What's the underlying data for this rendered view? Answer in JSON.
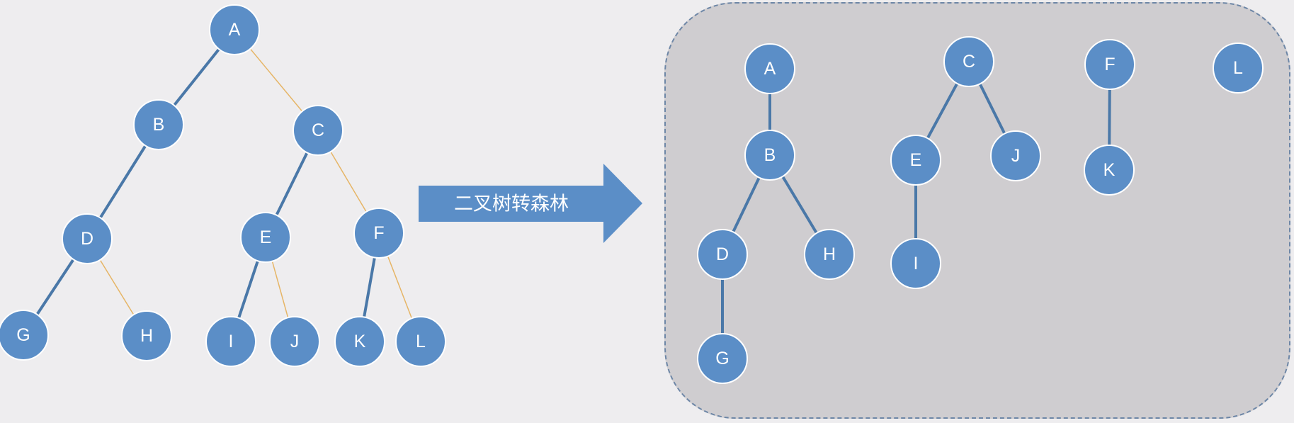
{
  "colors": {
    "background": "#eeedef",
    "panel": "#cfcdd0",
    "panel_border": "#6d86a6",
    "node_fill": "#5b8ec7",
    "node_stroke": "#ffffff",
    "child_edge": "#4a78a8",
    "sibling_edge": "#e6b566",
    "arrow_fill": "#5b8ec7"
  },
  "arrow": {
    "label": "二叉树转森林"
  },
  "binary_tree": {
    "nodes": [
      "A",
      "B",
      "C",
      "D",
      "E",
      "F",
      "G",
      "H",
      "I",
      "J",
      "K",
      "L"
    ],
    "edges": [
      {
        "from": "A",
        "to": "B",
        "kind": "left-child"
      },
      {
        "from": "A",
        "to": "C",
        "kind": "right-sibling"
      },
      {
        "from": "B",
        "to": "D",
        "kind": "left-child"
      },
      {
        "from": "C",
        "to": "E",
        "kind": "left-child"
      },
      {
        "from": "C",
        "to": "F",
        "kind": "right-sibling"
      },
      {
        "from": "D",
        "to": "G",
        "kind": "left-child"
      },
      {
        "from": "D",
        "to": "H",
        "kind": "right-sibling"
      },
      {
        "from": "E",
        "to": "I",
        "kind": "left-child"
      },
      {
        "from": "E",
        "to": "J",
        "kind": "right-sibling"
      },
      {
        "from": "F",
        "to": "K",
        "kind": "left-child"
      },
      {
        "from": "F",
        "to": "L",
        "kind": "right-sibling"
      }
    ]
  },
  "forest": {
    "trees": [
      {
        "root": "A",
        "nodes": [
          "A",
          "B",
          "D",
          "H",
          "G"
        ],
        "edges": [
          {
            "from": "A",
            "to": "B"
          },
          {
            "from": "B",
            "to": "D"
          },
          {
            "from": "B",
            "to": "H"
          },
          {
            "from": "D",
            "to": "G"
          }
        ]
      },
      {
        "root": "C",
        "nodes": [
          "C",
          "E",
          "J",
          "I"
        ],
        "edges": [
          {
            "from": "C",
            "to": "E"
          },
          {
            "from": "C",
            "to": "J"
          },
          {
            "from": "E",
            "to": "I"
          }
        ]
      },
      {
        "root": "F",
        "nodes": [
          "F",
          "K"
        ],
        "edges": [
          {
            "from": "F",
            "to": "K"
          }
        ]
      },
      {
        "root": "L",
        "nodes": [
          "L"
        ],
        "edges": []
      }
    ]
  }
}
